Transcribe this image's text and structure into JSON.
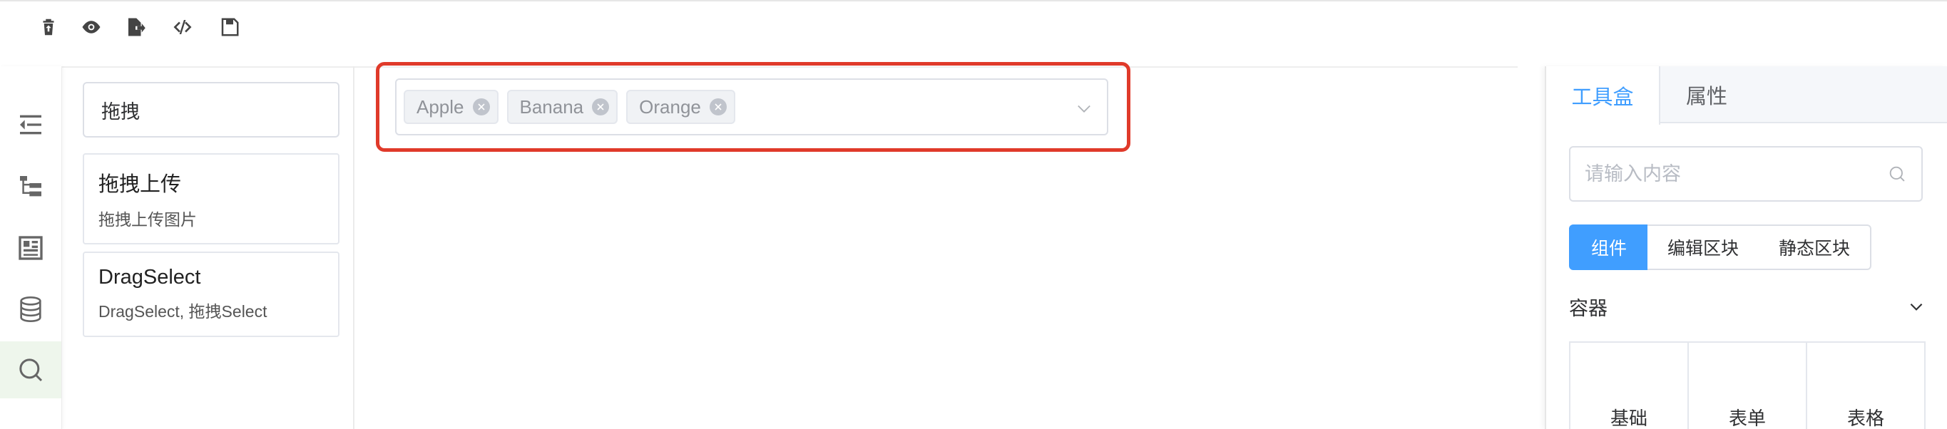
{
  "toolbar": {
    "icons": [
      "clear-icon",
      "preview-icon",
      "export-icon",
      "code-icon",
      "save-icon"
    ]
  },
  "rail": {
    "items": [
      "outdent-icon",
      "tree-icon",
      "layout-icon",
      "database-icon",
      "search-icon"
    ],
    "active": "search-icon"
  },
  "search": {
    "value": "拖拽",
    "results": [
      {
        "title": "拖拽上传",
        "subtitle": "拖拽上传图片"
      },
      {
        "title": "DragSelect",
        "subtitle": "DragSelect, 拖拽Select"
      }
    ]
  },
  "canvas": {
    "select": {
      "tags": [
        "Apple",
        "Banana",
        "Orange"
      ]
    },
    "highlight_color": "#e03a2a"
  },
  "rightpanel": {
    "tabs": [
      "工具盒",
      "属性"
    ],
    "active_tab": "工具盒",
    "search_placeholder": "请输入内容",
    "segments": [
      "组件",
      "编辑区块",
      "静态区块"
    ],
    "active_segment": "组件",
    "collapse_title": "容器",
    "grid": [
      "基础",
      "表单",
      "表格"
    ],
    "accent": "#409eff"
  }
}
